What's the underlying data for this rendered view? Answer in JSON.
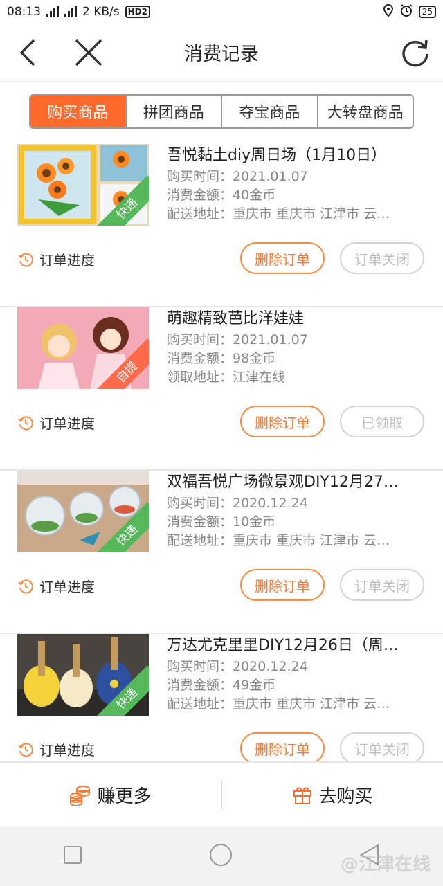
{
  "status": {
    "time": "08:13",
    "net1": "4G",
    "net2": "4G",
    "speed": "2 KB/s",
    "hd": "HD2",
    "battery": "25"
  },
  "header": {
    "title": "消费记录"
  },
  "tabs": [
    {
      "label": "购买商品",
      "active": true
    },
    {
      "label": "拼团商品",
      "active": false
    },
    {
      "label": "夺宝商品",
      "active": false
    },
    {
      "label": "大转盘商品",
      "active": false
    }
  ],
  "orders": [
    {
      "title": "吾悦黏土diy周日场（1月10日）",
      "time": "购买时间：2021.01.07",
      "amount": "消费金额：40金币",
      "address": "配送地址：重庆市 重庆市 江津市 云…",
      "tag": "快递",
      "progress_label": "订单进度",
      "delete_label": "删除订单",
      "state_label": "订单关闭"
    },
    {
      "title": "萌趣精致芭比洋娃娃",
      "time": "购买时间：2021.01.07",
      "amount": "消费金额：98金币",
      "address": "领取地址：江津在线",
      "tag": "自提",
      "progress_label": "订单进度",
      "delete_label": "删除订单",
      "state_label": "已领取"
    },
    {
      "title": "双福吾悦广场微景观DIY12月27…",
      "time": "购买时间：2020.12.24",
      "amount": "消费金额：10金币",
      "address": "配送地址：重庆市 重庆市 江津市 云…",
      "tag": "快递",
      "progress_label": "订单进度",
      "delete_label": "删除订单",
      "state_label": "订单关闭"
    },
    {
      "title": "万达尤克里里DIY12月26日（周…",
      "time": "购买时间：2020.12.24",
      "amount": "消费金额：49金币",
      "address": "配送地址：重庆市 重庆市 江津市 云…",
      "tag": "快递",
      "progress_label": "订单进度",
      "delete_label": "删除订单",
      "state_label": "订单关闭"
    }
  ],
  "bottom": {
    "earn_label": "赚更多",
    "buy_label": "去购买"
  },
  "watermark": "@江津在线",
  "colors": {
    "accent": "#ff6a2b",
    "express_tag": "#55b85b",
    "pickup_tag": "#ff6a4b"
  }
}
